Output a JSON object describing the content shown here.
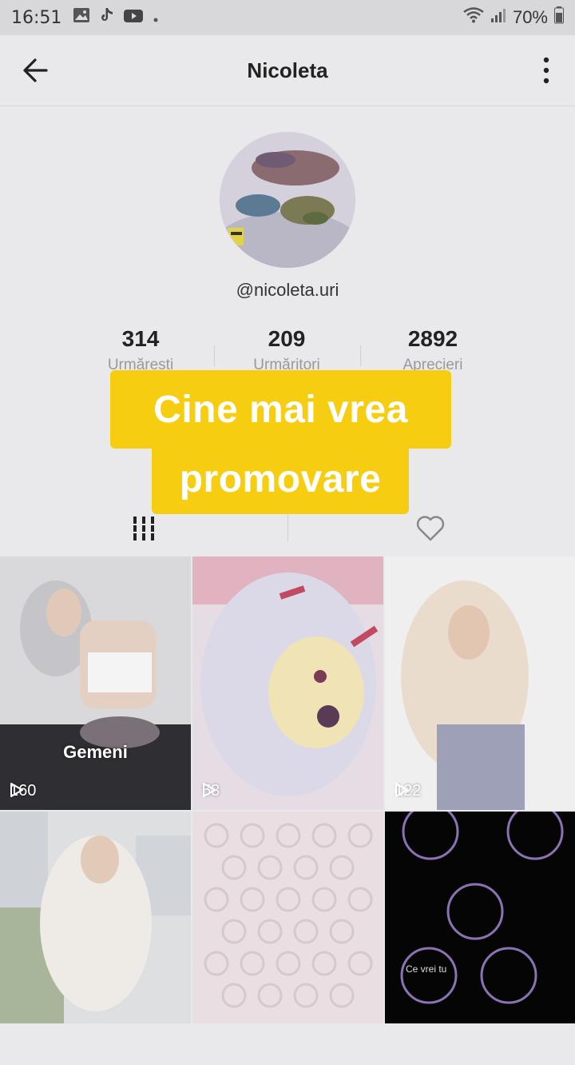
{
  "status_bar": {
    "time": "16:51",
    "battery": "70%",
    "icons": [
      "gallery-icon",
      "tiktok-icon",
      "youtube-icon",
      "dot-icon",
      "wifi-icon",
      "signal-icon",
      "battery-icon"
    ]
  },
  "header": {
    "title": "Nicoleta",
    "back_icon": "arrow-left-icon",
    "more_icon": "vertical-dots-icon"
  },
  "profile": {
    "handle": "@nicoleta.uri",
    "stats": [
      {
        "value": "314",
        "label": "Urmărești"
      },
      {
        "value": "209",
        "label": "Urmăritori"
      },
      {
        "value": "2892",
        "label": "Aprecieri"
      }
    ]
  },
  "caption": {
    "line1": "Cine mai vrea",
    "line2": "promovare",
    "color": "#f7cd12"
  },
  "tabs": [
    {
      "icon": "grid-icon",
      "active": true
    },
    {
      "icon": "heart-icon",
      "active": false
    }
  ],
  "videos": [
    {
      "views": "160",
      "overlay_text": "Gemeni"
    },
    {
      "views": "53",
      "overlay_text": ""
    },
    {
      "views": "122",
      "overlay_text": ""
    },
    {
      "views": "",
      "overlay_text": ""
    },
    {
      "views": "",
      "overlay_text": ""
    },
    {
      "views": "",
      "overlay_text": "Ce vrei tu"
    }
  ]
}
